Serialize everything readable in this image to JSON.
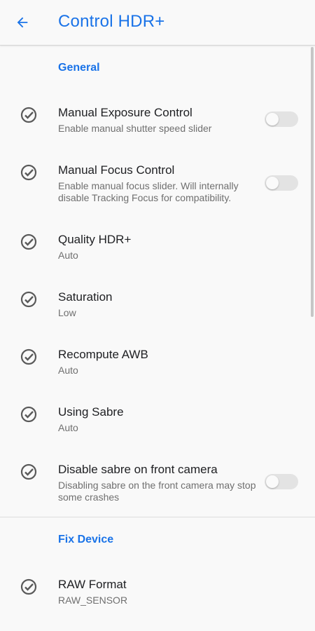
{
  "appbar": {
    "title": "Control HDR+"
  },
  "sections": [
    {
      "header": "General"
    },
    {
      "header": "Fix Device"
    }
  ],
  "items": [
    {
      "label": "Manual Exposure Control",
      "summary": "Enable manual shutter speed slider",
      "toggle": false
    },
    {
      "label": "Manual Focus Control",
      "summary": "Enable manual focus slider. Will internally disable Tracking Focus for compatibility.",
      "toggle": false
    },
    {
      "label": "Quality HDR+",
      "summary": "Auto"
    },
    {
      "label": "Saturation",
      "summary": "Low"
    },
    {
      "label": "Recompute AWB",
      "summary": "Auto"
    },
    {
      "label": "Using Sabre",
      "summary": "Auto"
    },
    {
      "label": "Disable sabre on front camera",
      "summary": "Disabling sabre on the front camera may stop some crashes",
      "toggle": false
    },
    {
      "label": "RAW Format",
      "summary": "RAW_SENSOR"
    }
  ],
  "colors": {
    "accent": "#1a73e8",
    "text": "#202124",
    "summary": "#6f6f6f"
  },
  "icons": {
    "back": "arrow-left-icon",
    "item": "check-circle-icon"
  }
}
